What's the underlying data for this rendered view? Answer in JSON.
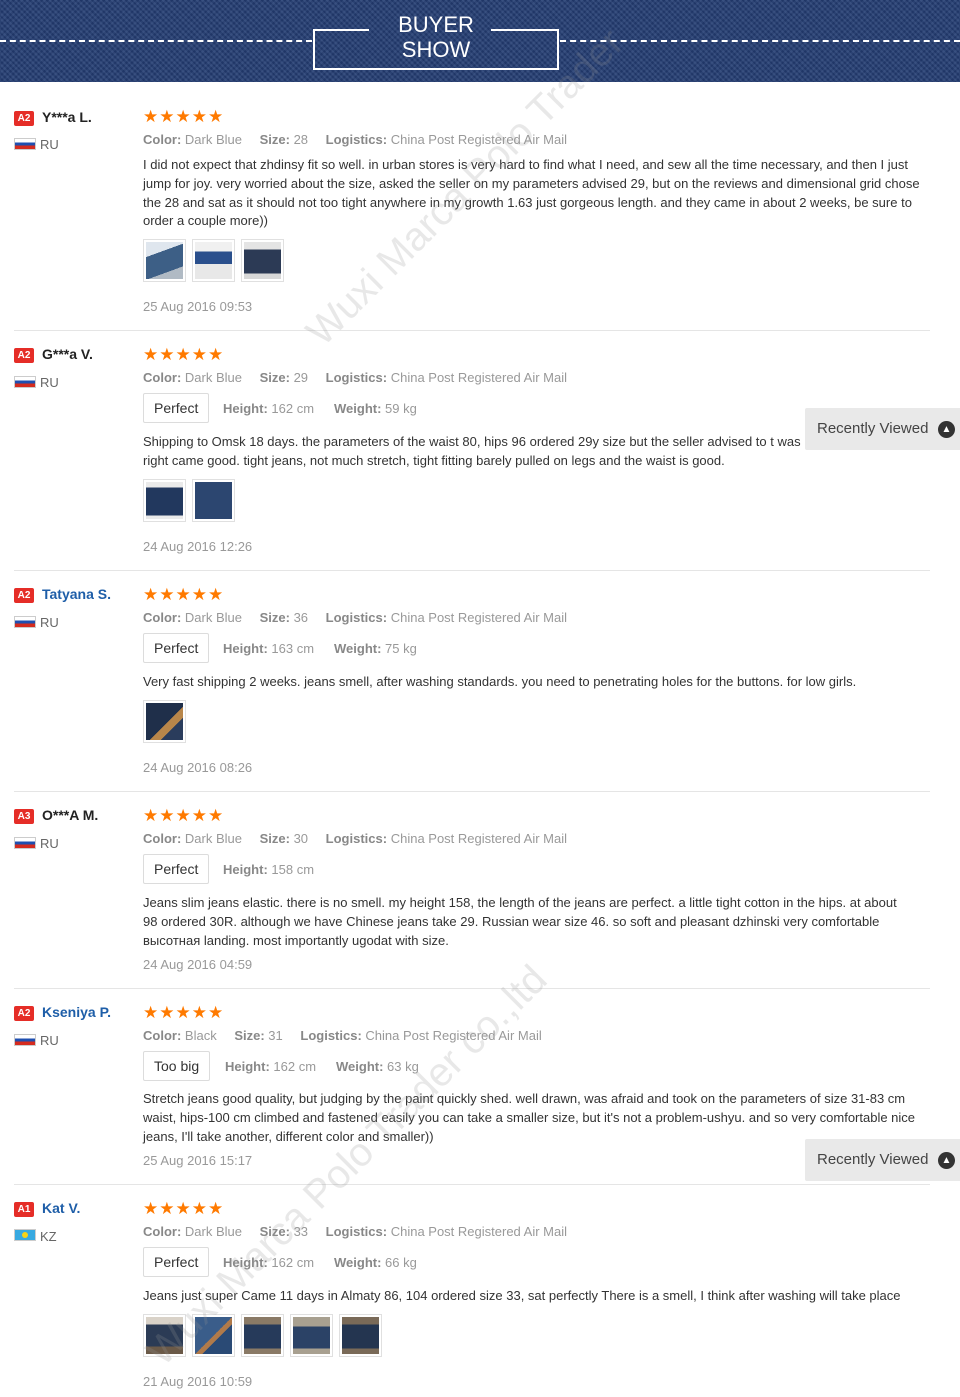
{
  "banner": {
    "title_line1": "BUYER",
    "title_line2": "SHOW"
  },
  "recently_viewed": {
    "label": "Recently Viewed",
    "icon": "chevron-up-circle-icon"
  },
  "watermarks": [
    "Wuxi Marca Polo Trader",
    "Wuxi Marca Polo Trader co.,ltd"
  ],
  "colors": {
    "banner": "#243d73",
    "badge": "#e52d27",
    "stars": "#ff7a00",
    "name_link": "#1e5ea8"
  },
  "labels": {
    "color": "Color:",
    "size": "Size:",
    "logistics": "Logistics:",
    "height": "Height:",
    "weight": "Weight:"
  },
  "reviews": [
    {
      "badge": "A2",
      "name": "Y***a L.",
      "country": "RU",
      "rating": 5,
      "color": "Dark Blue",
      "size": "28",
      "logistics": "China Post Registered Air Mail",
      "text": "I did not expect that zhdinsy fit so well. in urban stores is very hard to find what I need, and sew all the time necessary, and then I just jump for joy. very worried about the size, asked the seller on my parameters advised 29, but on the reviews and dimensional grid chose the 28 and sat as it should not too tight anywhere in my growth 1.63 just gorgeous length. and they came in about 2 weeks, be sure to order a couple more))",
      "photos": 3,
      "date": "25 Aug 2016 09:53"
    },
    {
      "badge": "A2",
      "name": "G***a V.",
      "country": "RU",
      "rating": 5,
      "color": "Dark Blue",
      "size": "29",
      "logistics": "China Post Registered Air Mail",
      "fit": "Perfect",
      "height": "162 cm",
      "weight": "59 kg",
      "text": "Shipping to Omsk 18 days. the parameters of the waist 80, hips 96 ordered 29y size but the seller advised to t was right came good. tight jeans, not much stretch, tight fitting barely pulled on legs and the waist is good.",
      "photos": 2,
      "date": "24 Aug 2016 12:26"
    },
    {
      "badge": "A2",
      "name": "Tatyana S.",
      "country": "RU",
      "rating": 5,
      "color": "Dark Blue",
      "size": "36",
      "logistics": "China Post Registered Air Mail",
      "fit": "Perfect",
      "height": "163 cm",
      "weight": "75 kg",
      "text": "Very fast shipping 2 weeks. jeans smell, after washing standards. you need to penetrating holes for the buttons. for low girls.",
      "photos": 1,
      "date": "24 Aug 2016 08:26"
    },
    {
      "badge": "A3",
      "name": "O***A M.",
      "country": "RU",
      "rating": 5,
      "color": "Dark Blue",
      "size": "30",
      "logistics": "China Post Registered Air Mail",
      "fit": "Perfect",
      "height": "158 cm",
      "text": "Jeans slim jeans elastic. there is no smell. my height 158, the length of the jeans are perfect. a little tight cotton in the hips. at about 98 ordered 30R. although we have Chinese jeans take 29. Russian wear size 46. so soft and pleasant dzhinski very comfortable высотная landing. most importantly ugodat with size.",
      "photos": 0,
      "date": "24 Aug 2016 04:59"
    },
    {
      "badge": "A2",
      "name": "Kseniya P.",
      "country": "RU",
      "rating": 5,
      "color": "Black",
      "size": "31",
      "logistics": "China Post Registered Air Mail",
      "fit": "Too big",
      "height": "162 cm",
      "weight": "63 kg",
      "text": "Stretch jeans good quality, but judging by the paint quickly shed. well drawn, was afraid and took on the parameters of size 31-83 cm waist, hips-100 cm climbed and fastened easily you can take a smaller size, but it's not a problem-ushyu. and so very comfortable nice jeans, I'll take another, different color and smaller))",
      "photos": 0,
      "date": "25 Aug 2016 15:17"
    },
    {
      "badge": "A1",
      "name": "Kat V.",
      "country": "KZ",
      "rating": 5,
      "color": "Dark Blue",
      "size": "33",
      "logistics": "China Post Registered Air Mail",
      "fit": "Perfect",
      "height": "162 cm",
      "weight": "66 kg",
      "text": "Jeans just super Came 11 days in Almaty 86, 104 ordered size 33, sat perfectly There is a smell, I think after washing will take place",
      "photos": 5,
      "date": "21 Aug 2016 10:59"
    }
  ]
}
